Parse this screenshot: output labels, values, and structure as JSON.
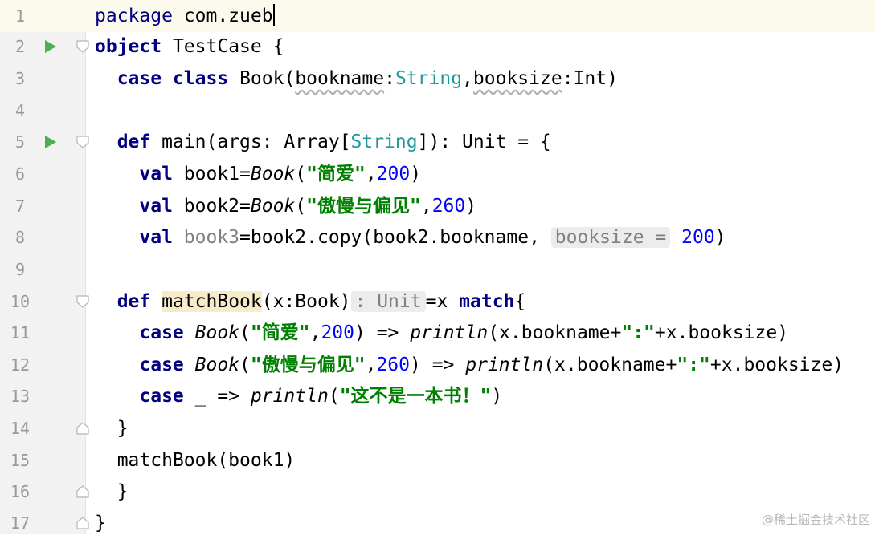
{
  "editor": {
    "lines": [
      {
        "num": "1"
      },
      {
        "num": "2"
      },
      {
        "num": "3"
      },
      {
        "num": "4"
      },
      {
        "num": "5"
      },
      {
        "num": "6"
      },
      {
        "num": "7"
      },
      {
        "num": "8"
      },
      {
        "num": "9"
      },
      {
        "num": "10"
      },
      {
        "num": "11"
      },
      {
        "num": "12"
      },
      {
        "num": "13"
      },
      {
        "num": "14"
      },
      {
        "num": "15"
      },
      {
        "num": "16"
      },
      {
        "num": "17"
      }
    ],
    "colors": {
      "keyword": "#000080",
      "type": "#20999d",
      "number": "#0000ff",
      "string": "#008000",
      "run_icon": "#4caf50",
      "current_line": "#fcfaed"
    },
    "code": {
      "l1": {
        "kw": "package",
        "pkg": "com.zueb"
      },
      "l2": {
        "kw": "object",
        "name": "TestCase {"
      },
      "l3": {
        "kw1": "case",
        "kw2": "class",
        "name": "Book(",
        "p1": "bookname",
        "colon1": ":",
        "t1": "String",
        "comma": ",",
        "p2": "booksize",
        "colon2": ":",
        "t2": "Int",
        "close": ")"
      },
      "l5": {
        "kw": "def",
        "sig1": "main(args: Array[",
        "t": "String",
        "sig2": "]): Unit = {"
      },
      "l6": {
        "kw": "val",
        "var": "book1=",
        "ctor": "Book",
        "open": "(",
        "str": "\"简爱\"",
        "comma": ",",
        "num": "200",
        "close": ")"
      },
      "l7": {
        "kw": "val",
        "var": "book2=",
        "ctor": "Book",
        "open": "(",
        "str": "\"傲慢与偏见\"",
        "comma": ",",
        "num": "260",
        "close": ")"
      },
      "l8": {
        "kw": "val",
        "var": "book3",
        "rest": "=book2.copy(book2.bookname,",
        "hint": "booksize =",
        "num": "200",
        "close": ")"
      },
      "l10": {
        "kw": "def",
        "fn": "matchBook",
        "params": "(x:Book)",
        "hint": ": Unit",
        "rest": "=x",
        "kw2": "match",
        "brace": "{"
      },
      "l11": {
        "kw": "case",
        "ctor": "Book",
        "open": "(",
        "str": "\"简爱\"",
        "comma": ",",
        "num": "200",
        "arrow": ") =>",
        "fn": "println",
        "rest1": "(x.bookname+",
        "str2": "\":\"",
        "rest2": "+x.booksize)"
      },
      "l12": {
        "kw": "case",
        "ctor": "Book",
        "open": "(",
        "str": "\"傲慢与偏见\"",
        "comma": ",",
        "num": "260",
        "arrow": ") =>",
        "fn": "println",
        "rest1": "(x.bookname+",
        "str2": "\":\"",
        "rest2": "+x.booksize)"
      },
      "l13": {
        "kw": "case",
        "rest": "_ =>",
        "fn": "println",
        "open": "(",
        "str": "\"这不是一本书！\"",
        "close": ")"
      },
      "l14": {
        "text": "}"
      },
      "l15": {
        "text": "matchBook(book1)"
      },
      "l16": {
        "text": "}"
      },
      "l17": {
        "text": "}"
      }
    }
  },
  "watermark": "@稀土掘金技术社区"
}
